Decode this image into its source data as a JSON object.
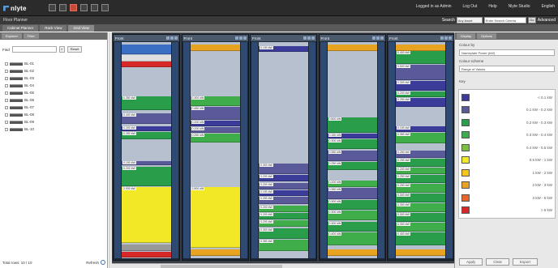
{
  "app": {
    "brand": "nlyte",
    "window_title": "Floor Planner"
  },
  "topnav": [
    {
      "label": "Logged in as Admin"
    },
    {
      "label": "Log Out"
    },
    {
      "label": "Help"
    },
    {
      "label": "Nlyte Studio"
    },
    {
      "label": "English"
    }
  ],
  "search": {
    "label": "Search",
    "scope_value": "Any Asset",
    "placeholder": "Enter Search Criteria",
    "go_label": "Go",
    "advanced_label": "Advanced"
  },
  "tabs": [
    {
      "label": "Cabinet Planner",
      "active": false
    },
    {
      "label": "Rack View",
      "active": false
    },
    {
      "label": "Grid View",
      "active": true
    }
  ],
  "left_panel": {
    "tabs": [
      {
        "label": "Explorer"
      },
      {
        "label": "Filter"
      }
    ],
    "find_label": "Find",
    "find_button": "Reset",
    "tree": [
      {
        "label": "BL-01"
      },
      {
        "label": "BL-02"
      },
      {
        "label": "BL-03"
      },
      {
        "label": "BL-04"
      },
      {
        "label": "BL-05"
      },
      {
        "label": "BL-06"
      },
      {
        "label": "BL-07"
      },
      {
        "label": "BL-08"
      },
      {
        "label": "BL-09"
      },
      {
        "label": "BL-10"
      }
    ],
    "footer": {
      "status": "Total rows: 10 / 10",
      "refresh_label": "Refresh"
    }
  },
  "racks": [
    {
      "title": "Front",
      "devices": [
        {
          "top": 0.01,
          "h": 0.045,
          "color": "#3b6fc4",
          "label": ""
        },
        {
          "top": 0.06,
          "h": 0.03,
          "color": "#e0e0e0",
          "label": ""
        },
        {
          "top": 0.09,
          "h": 0.025,
          "color": "#d62828",
          "label": ""
        },
        {
          "top": 0.25,
          "h": 0.065,
          "color": "#2a9d4a",
          "label": "0.350 kW"
        },
        {
          "top": 0.33,
          "h": 0.05,
          "color": "#5a5a9a",
          "label": "0.400 kW"
        },
        {
          "top": 0.39,
          "h": 0.022,
          "color": "#3b3b9a",
          "label": "0.200 kW"
        },
        {
          "top": 0.415,
          "h": 0.035,
          "color": "#2a9d4a",
          "label": "0.250 kW"
        },
        {
          "top": 0.55,
          "h": 0.02,
          "color": "#5a5a9a",
          "label": "0.150 kW"
        },
        {
          "top": 0.575,
          "h": 0.09,
          "color": "#2a9d4a",
          "label": "0.200 kW"
        },
        {
          "top": 0.67,
          "h": 0.26,
          "color": "#f2e826",
          "label": "2.000 kW"
        },
        {
          "top": 0.935,
          "h": 0.03,
          "color": "#999999",
          "label": ""
        },
        {
          "top": 0.97,
          "h": 0.025,
          "color": "#d62828",
          "label": ""
        }
      ]
    },
    {
      "title": "Front",
      "devices": [
        {
          "top": 0.01,
          "h": 0.03,
          "color": "#e8a321",
          "label": ""
        },
        {
          "top": 0.25,
          "h": 0.045,
          "color": "#3fae4a",
          "label": "0.300 kW"
        },
        {
          "top": 0.3,
          "h": 0.06,
          "color": "#5a5a9a",
          "label": "0.450 kW"
        },
        {
          "top": 0.365,
          "h": 0.025,
          "color": "#3b3b9a",
          "label": "0.200 kW"
        },
        {
          "top": 0.395,
          "h": 0.025,
          "color": "#5a5a9a",
          "label": "0.200 kW"
        },
        {
          "top": 0.425,
          "h": 0.04,
          "color": "#3fae4a",
          "label": "0.250 kW"
        },
        {
          "top": 0.67,
          "h": 0.28,
          "color": "#f2e826",
          "label": "2.500 kW"
        },
        {
          "top": 0.96,
          "h": 0.03,
          "color": "#e8a321",
          "label": ""
        }
      ]
    },
    {
      "title": "Front",
      "devices": [
        {
          "top": 0.02,
          "h": 0.025,
          "color": "#3b3b9a",
          "label": "0.150 kW"
        },
        {
          "top": 0.56,
          "h": 0.05,
          "color": "#5a5a9a",
          "label": "0.300 kW"
        },
        {
          "top": 0.615,
          "h": 0.03,
          "color": "#3b3b9a",
          "label": "0.200 kW"
        },
        {
          "top": 0.65,
          "h": 0.03,
          "color": "#5a5a9a",
          "label": "0.200 kW"
        },
        {
          "top": 0.685,
          "h": 0.025,
          "color": "#3b3b9a",
          "label": "0.150 kW"
        },
        {
          "top": 0.715,
          "h": 0.035,
          "color": "#5a5a9a",
          "label": "0.250 kW"
        },
        {
          "top": 0.755,
          "h": 0.03,
          "color": "#3fae4a",
          "label": "0.200 kW"
        },
        {
          "top": 0.79,
          "h": 0.03,
          "color": "#2a9d4a",
          "label": "0.200 kW"
        },
        {
          "top": 0.825,
          "h": 0.03,
          "color": "#3fae4a",
          "label": "0.200 kW"
        },
        {
          "top": 0.86,
          "h": 0.05,
          "color": "#2a9d4a",
          "label": "0.300 kW"
        },
        {
          "top": 0.915,
          "h": 0.05,
          "color": "#3fae4a",
          "label": "0.350 kW"
        }
      ]
    },
    {
      "title": "Front",
      "devices": [
        {
          "top": 0.01,
          "h": 0.03,
          "color": "#e8a321",
          "label": ""
        },
        {
          "top": 0.35,
          "h": 0.07,
          "color": "#2a9d4a",
          "label": "0.500 kW"
        },
        {
          "top": 0.425,
          "h": 0.02,
          "color": "#3b3b9a",
          "label": "0.150 kW"
        },
        {
          "top": 0.45,
          "h": 0.045,
          "color": "#2a9d4a",
          "label": "0.300 kW"
        },
        {
          "top": 0.5,
          "h": 0.05,
          "color": "#5a5a9a",
          "label": "0.350 kW"
        },
        {
          "top": 0.555,
          "h": 0.035,
          "color": "#2a9d4a",
          "label": "0.250 kW"
        },
        {
          "top": 0.64,
          "h": 0.03,
          "color": "#3fae4a",
          "label": "0.200 kW"
        },
        {
          "top": 0.675,
          "h": 0.05,
          "color": "#5a5a9a",
          "label": "0.350 kW"
        },
        {
          "top": 0.73,
          "h": 0.045,
          "color": "#2a9d4a",
          "label": "0.300 kW"
        },
        {
          "top": 0.78,
          "h": 0.045,
          "color": "#3fae4a",
          "label": "0.300 kW"
        },
        {
          "top": 0.83,
          "h": 0.045,
          "color": "#2a9d4a",
          "label": "0.300 kW"
        },
        {
          "top": 0.88,
          "h": 0.06,
          "color": "#3fae4a",
          "label": "0.400 kW"
        },
        {
          "top": 0.96,
          "h": 0.03,
          "color": "#e8a321",
          "label": ""
        }
      ]
    },
    {
      "title": "Front",
      "devices": [
        {
          "top": 0.01,
          "h": 0.03,
          "color": "#e8a321",
          "label": ""
        },
        {
          "top": 0.04,
          "h": 0.06,
          "color": "#2a9d4a",
          "label": "0.400 kW"
        },
        {
          "top": 0.105,
          "h": 0.07,
          "color": "#5a5a9a",
          "label": "0.500 kW"
        },
        {
          "top": 0.18,
          "h": 0.045,
          "color": "#3b3b9a",
          "label": "0.300 kW"
        },
        {
          "top": 0.23,
          "h": 0.025,
          "color": "#2a9d4a",
          "label": "0.200 kW"
        },
        {
          "top": 0.26,
          "h": 0.04,
          "color": "#3b3b9a",
          "label": "0.250 kW"
        },
        {
          "top": 0.39,
          "h": 0.025,
          "color": "#3b3b9a",
          "label": "0.150 kW"
        },
        {
          "top": 0.42,
          "h": 0.05,
          "color": "#3fae4a",
          "label": "0.350 kW"
        },
        {
          "top": 0.5,
          "h": 0.035,
          "color": "#5a5a9a",
          "label": "0.250 kW"
        },
        {
          "top": 0.54,
          "h": 0.035,
          "color": "#2a9d4a",
          "label": "0.250 kW"
        },
        {
          "top": 0.58,
          "h": 0.03,
          "color": "#3fae4a",
          "label": "0.200 kW"
        },
        {
          "top": 0.615,
          "h": 0.035,
          "color": "#2a9d4a",
          "label": "0.250 kW"
        },
        {
          "top": 0.655,
          "h": 0.04,
          "color": "#3fae4a",
          "label": "0.250 kW"
        },
        {
          "top": 0.7,
          "h": 0.04,
          "color": "#2a9d4a",
          "label": "0.300 kW"
        },
        {
          "top": 0.745,
          "h": 0.04,
          "color": "#3fae4a",
          "label": "0.300 kW"
        },
        {
          "top": 0.79,
          "h": 0.04,
          "color": "#2a9d4a",
          "label": "0.300 kW"
        },
        {
          "top": 0.835,
          "h": 0.04,
          "color": "#3fae4a",
          "label": "0.300 kW"
        },
        {
          "top": 0.88,
          "h": 0.06,
          "color": "#2a9d4a",
          "label": "0.400 kW"
        },
        {
          "top": 0.96,
          "h": 0.03,
          "color": "#e8a321",
          "label": ""
        }
      ]
    }
  ],
  "right_panel": {
    "tabs": [
      {
        "label": "Display"
      },
      {
        "label": "Options"
      }
    ],
    "color_by_label": "Colour by",
    "color_by_value": "Nameplate Power (kW)",
    "scheme_label": "Colour scheme",
    "scheme_value": "Range of Values",
    "key_label": "Key",
    "legend": [
      {
        "color": "#3b3b9a",
        "text": "< 0.1 kW"
      },
      {
        "color": "#5a5a9a",
        "text": "0.1 kW - 0.2 kW"
      },
      {
        "color": "#2a9d4a",
        "text": "0.2 kW - 0.3 kW"
      },
      {
        "color": "#3fae4a",
        "text": "0.3 kW - 0.4 kW"
      },
      {
        "color": "#7bc043",
        "text": "0.4 kW - 0.5 kW"
      },
      {
        "color": "#f2e826",
        "text": "0.5 kW - 1 kW"
      },
      {
        "color": "#f5c518",
        "text": "1 kW - 2 kW"
      },
      {
        "color": "#e8a321",
        "text": "2 kW - 3 kW"
      },
      {
        "color": "#e8662b",
        "text": "3 kW - 5 kW"
      },
      {
        "color": "#d62828",
        "text": "> 5 kW"
      }
    ],
    "buttons": [
      {
        "label": "Apply"
      },
      {
        "label": "Clear"
      },
      {
        "label": "Export"
      }
    ]
  }
}
